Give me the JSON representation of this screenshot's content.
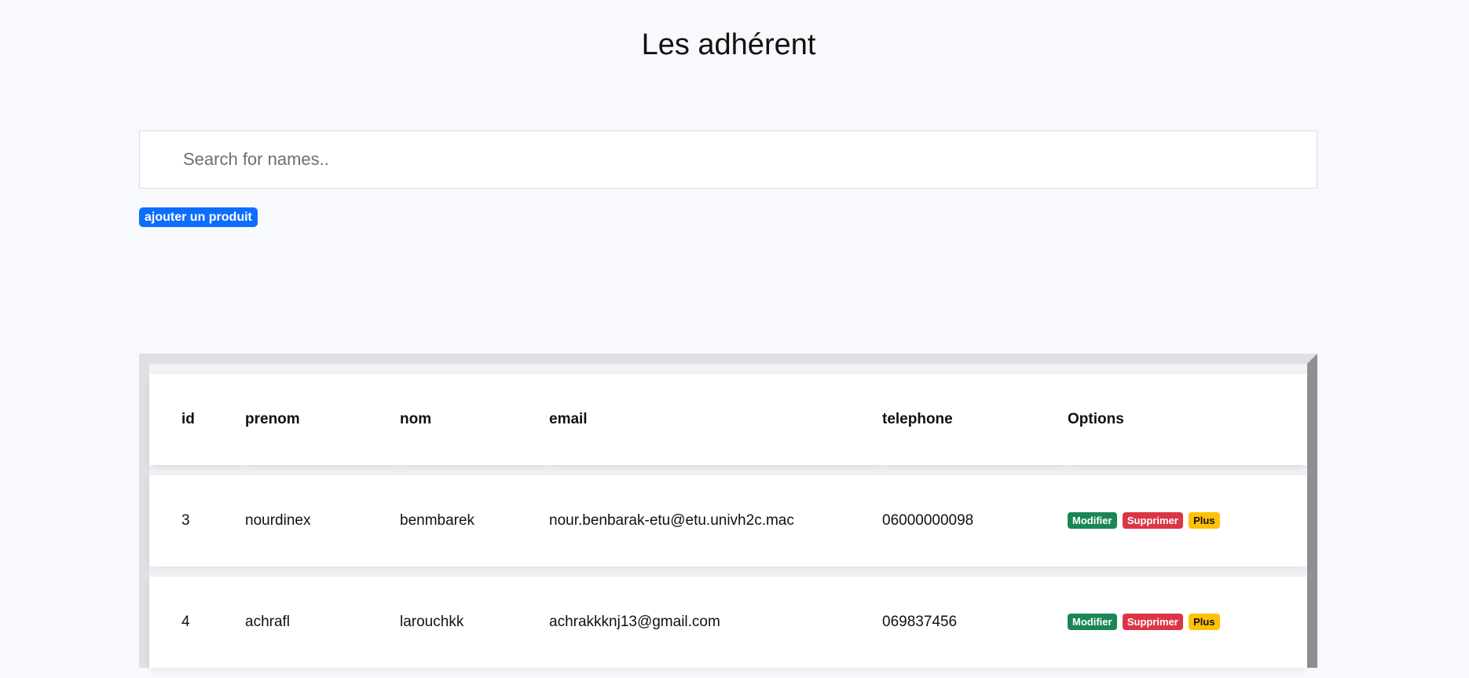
{
  "page": {
    "title": "Les adhérent"
  },
  "search": {
    "placeholder": "Search for names..",
    "value": ""
  },
  "actions": {
    "add_label": "ajouter un produit"
  },
  "table": {
    "headers": {
      "id": "id",
      "prenom": "prenom",
      "nom": "nom",
      "email": "email",
      "telephone": "telephone",
      "options": "Options"
    },
    "rows": [
      {
        "id": "3",
        "prenom": "nourdinex",
        "nom": "benmbarek",
        "email": "nour.benbarak-etu@etu.univh2c.mac",
        "telephone": "06000000098",
        "modifier": "Modifier",
        "supprimer": "Supprimer",
        "plus": "Plus"
      },
      {
        "id": "4",
        "prenom": "achrafl",
        "nom": "larouchkk",
        "email": "achrakkknj13@gmail.com",
        "telephone": "069837456",
        "modifier": "Modifier",
        "supprimer": "Supprimer",
        "plus": "Plus"
      }
    ]
  },
  "colors": {
    "primary": "#0d6efd",
    "success": "#198754",
    "danger": "#dc3545",
    "warning": "#ffc107",
    "background": "#f8f9fc"
  }
}
